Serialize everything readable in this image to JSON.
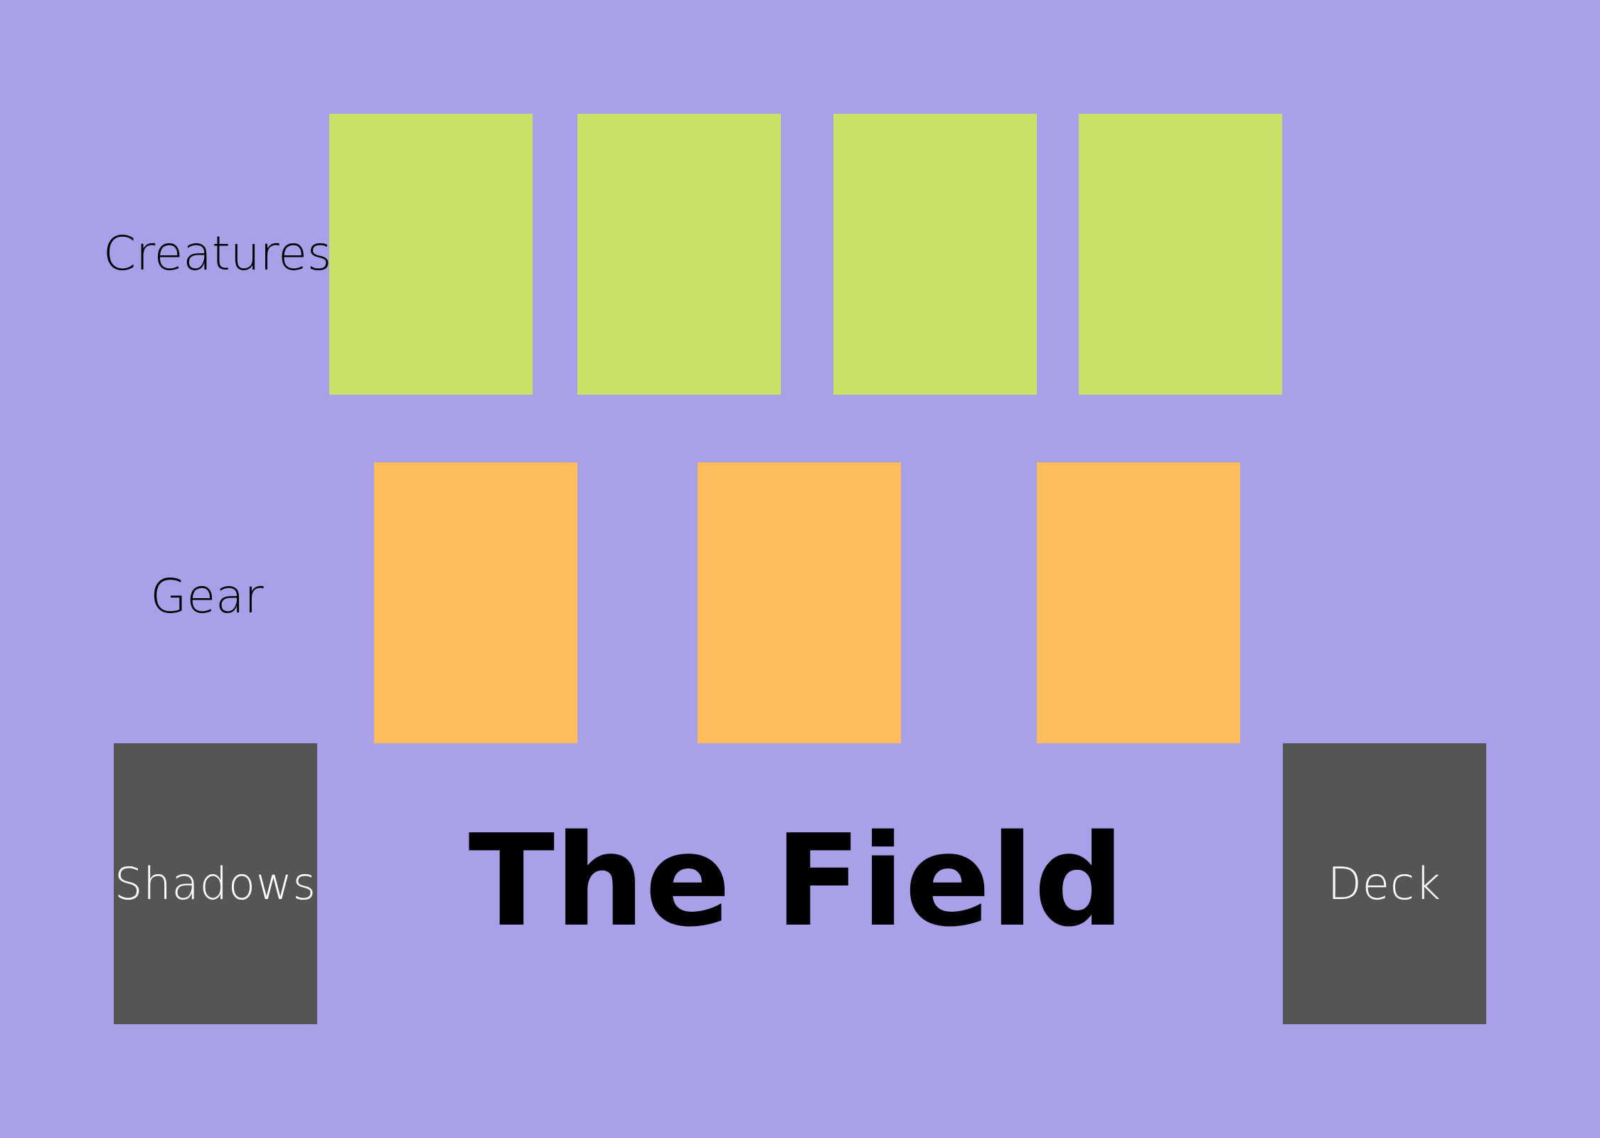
{
  "board": {
    "background_color": "#a9a0ea",
    "title": "The Field"
  },
  "rows": {
    "creatures": {
      "label": "Creatures",
      "slot_count": 4,
      "slot_color": "#c9e166"
    },
    "gear": {
      "label": "Gear",
      "slot_count": 3,
      "slot_color": "#febd5c"
    }
  },
  "piles": {
    "shadows": {
      "label": "Shadows",
      "color": "#555555"
    },
    "deck": {
      "label": "Deck",
      "color": "#555555"
    }
  }
}
